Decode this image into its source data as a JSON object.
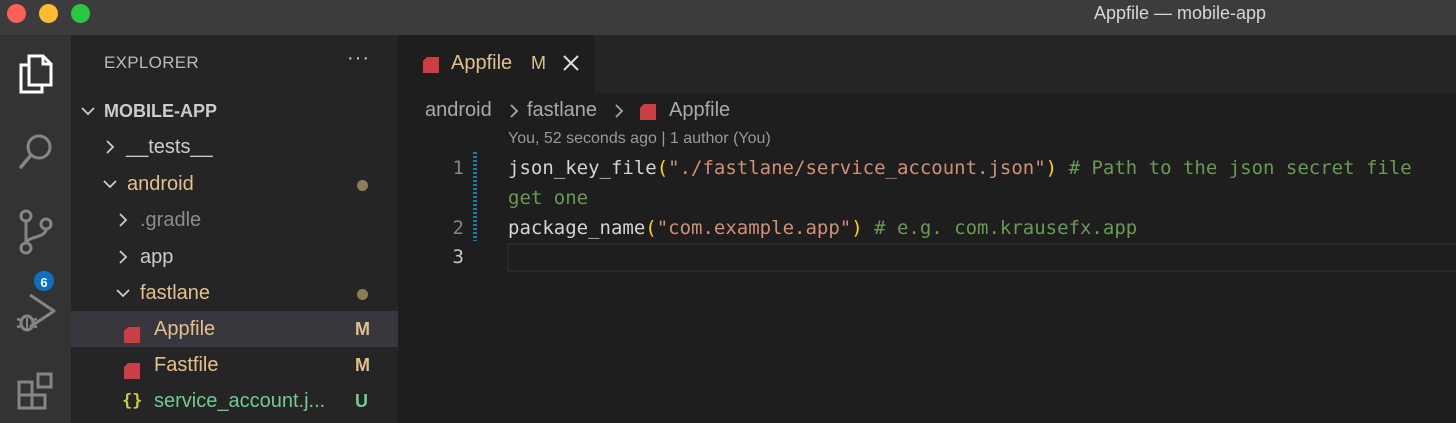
{
  "window": {
    "title": "Appfile — mobile-app"
  },
  "activity_bar": {
    "items": [
      "explorer-icon",
      "search-icon",
      "source-control-icon",
      "run-debug-icon",
      "extensions-icon"
    ],
    "source_control_badge": "6"
  },
  "sidebar": {
    "header": "EXPLORER",
    "more_label": "···",
    "tree": [
      {
        "label": "MOBILE-APP",
        "status": ""
      },
      {
        "label": "__tests__",
        "status": ""
      },
      {
        "label": "android",
        "status": "dot"
      },
      {
        "label": ".gradle",
        "status": ""
      },
      {
        "label": "app",
        "status": ""
      },
      {
        "label": "fastlane",
        "status": "dot"
      },
      {
        "label": "Appfile",
        "status": "M"
      },
      {
        "label": "Fastfile",
        "status": "M"
      },
      {
        "label": "service_account.j...",
        "status": "U"
      }
    ]
  },
  "editor": {
    "tab": {
      "name": "Appfile",
      "status": "M"
    },
    "breadcrumb": [
      "android",
      "fastlane",
      "Appfile"
    ],
    "codelens": "You, 52 seconds ago | 1 author (You)",
    "line_numbers": [
      "1",
      "2",
      "3"
    ],
    "lines": {
      "l1_fn": "json_key_file",
      "l1_open": "(",
      "l1_str": "\"./fastlane/service_account.json\"",
      "l1_close": ")",
      "l1_comment": " # Path to the json secret file",
      "l1_wrap": "get one",
      "l2_fn": "package_name",
      "l2_open": "(",
      "l2_str": "\"com.example.app\"",
      "l2_close": ")",
      "l2_comment": " # e.g. com.krausefx.app"
    }
  },
  "colors": {
    "modified": "#e2c08d",
    "untracked": "#73c991",
    "accent_badge": "#0e70c0",
    "ruby_icon": "#cc3e44"
  }
}
